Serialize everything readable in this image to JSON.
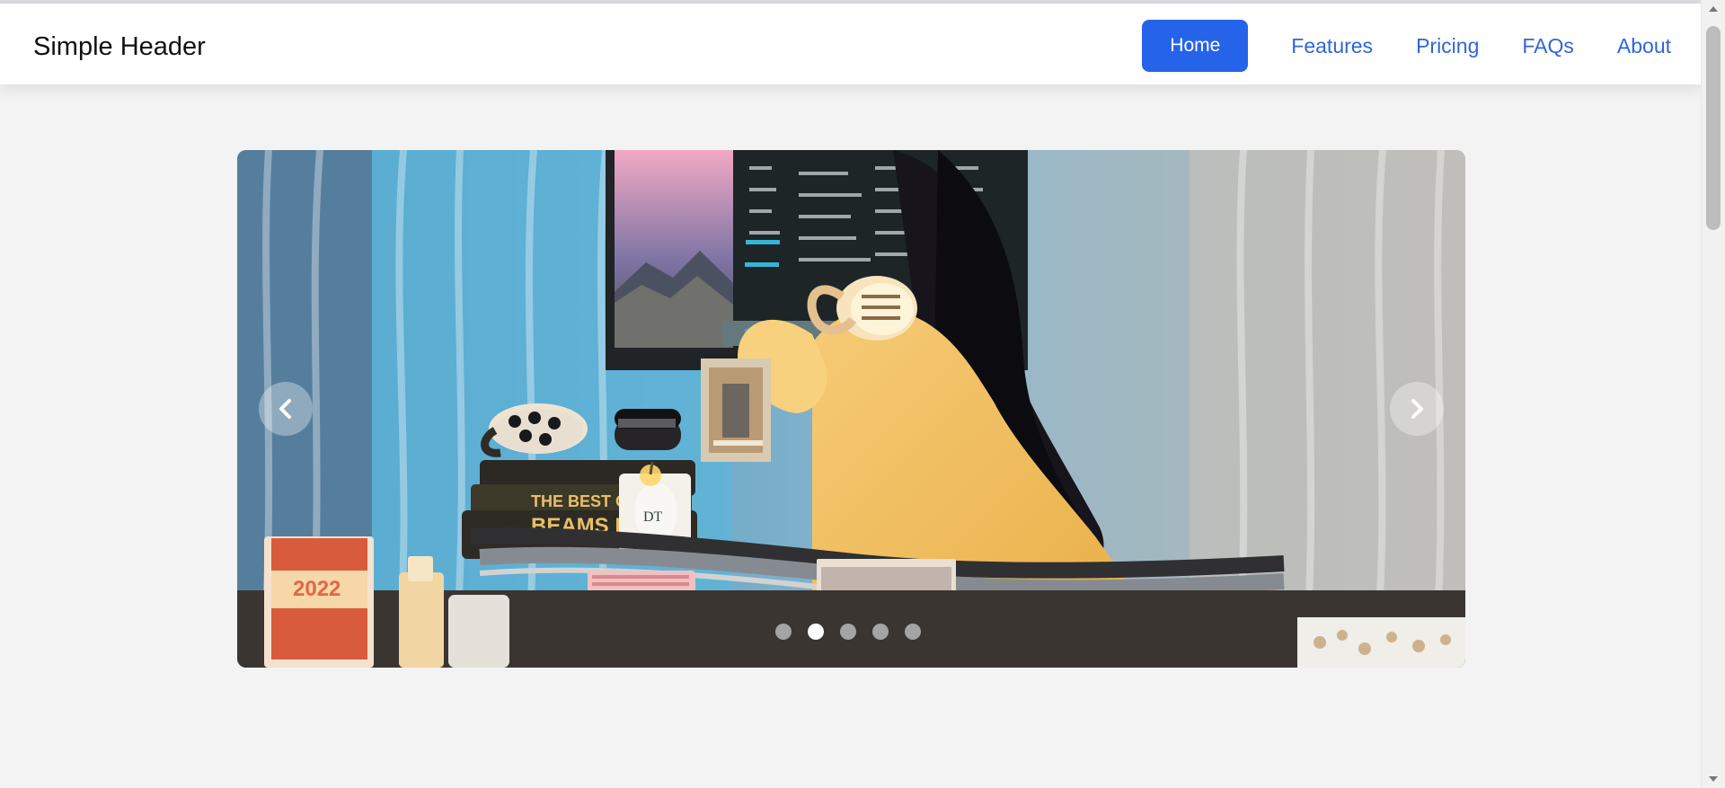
{
  "header": {
    "title": "Simple Header",
    "nav": [
      "Home",
      "Features",
      "Pricing",
      "FAQs",
      "About"
    ],
    "active_nav": "Home",
    "accent": "#2563eb",
    "link_color": "#2f66d6"
  },
  "carousel": {
    "current_slide": 2,
    "total_slides": 5,
    "previous_icon": "chevron-left-icon",
    "next_icon": "chevron-right-icon"
  },
  "scrollbar": {
    "visible": true
  }
}
